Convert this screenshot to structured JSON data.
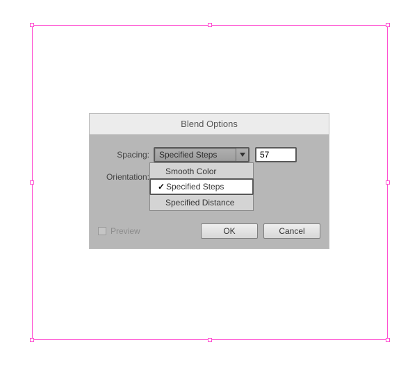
{
  "dialog": {
    "title": "Blend Options",
    "spacing_label": "Spacing:",
    "orientation_label": "Orientation:",
    "spacing_selected": "Specified Steps",
    "spacing_value": "57",
    "options": {
      "0": {
        "label": "Smooth Color"
      },
      "1": {
        "label": "Specified Steps"
      },
      "2": {
        "label": "Specified Distance"
      }
    },
    "preview_label": "Preview",
    "ok_label": "OK",
    "cancel_label": "Cancel",
    "checkmark": "✓"
  }
}
